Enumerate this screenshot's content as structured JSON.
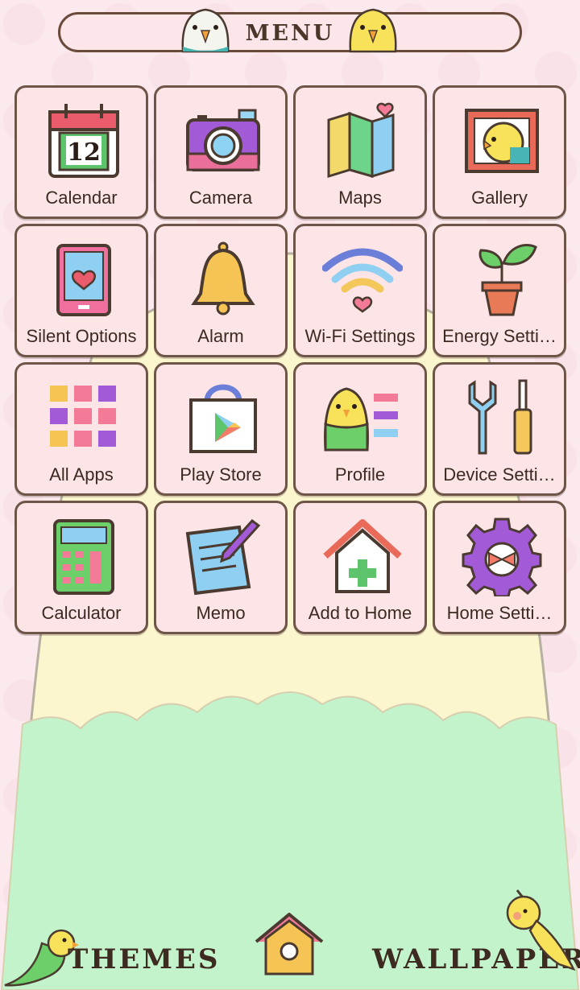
{
  "header": {
    "title": "MENU"
  },
  "tiles": [
    {
      "label": "Calendar",
      "day": "12"
    },
    {
      "label": "Camera"
    },
    {
      "label": "Maps"
    },
    {
      "label": "Gallery"
    },
    {
      "label": "Silent Options"
    },
    {
      "label": "Alarm"
    },
    {
      "label": "Wi-Fi Settings"
    },
    {
      "label": "Energy Setti…"
    },
    {
      "label": "All Apps"
    },
    {
      "label": "Play Store"
    },
    {
      "label": "Profile"
    },
    {
      "label": "Device Setti…"
    },
    {
      "label": "Calculator"
    },
    {
      "label": "Memo"
    },
    {
      "label": "Add to Home"
    },
    {
      "label": "Home Setti…"
    }
  ],
  "footer": {
    "themes": "THEMES",
    "wallpapers": "WALLPAPERS"
  },
  "colors": {
    "background_pink": "#fbe9ee",
    "dress_cream": "#fcf6cf",
    "dress_mint": "#c3f3cb",
    "tile_bg": "#fde4e6",
    "outline_brown": "#6e5547"
  },
  "icons": [
    "calendar-icon",
    "camera-icon",
    "map-icon",
    "gallery-icon",
    "tablet-heart-icon",
    "bell-icon",
    "wifi-icon",
    "plant-icon",
    "grid-icon",
    "store-bag-icon",
    "budgie-profile-icon",
    "tools-icon",
    "calculator-icon",
    "memo-icon",
    "house-plus-icon",
    "gear-bow-icon"
  ]
}
